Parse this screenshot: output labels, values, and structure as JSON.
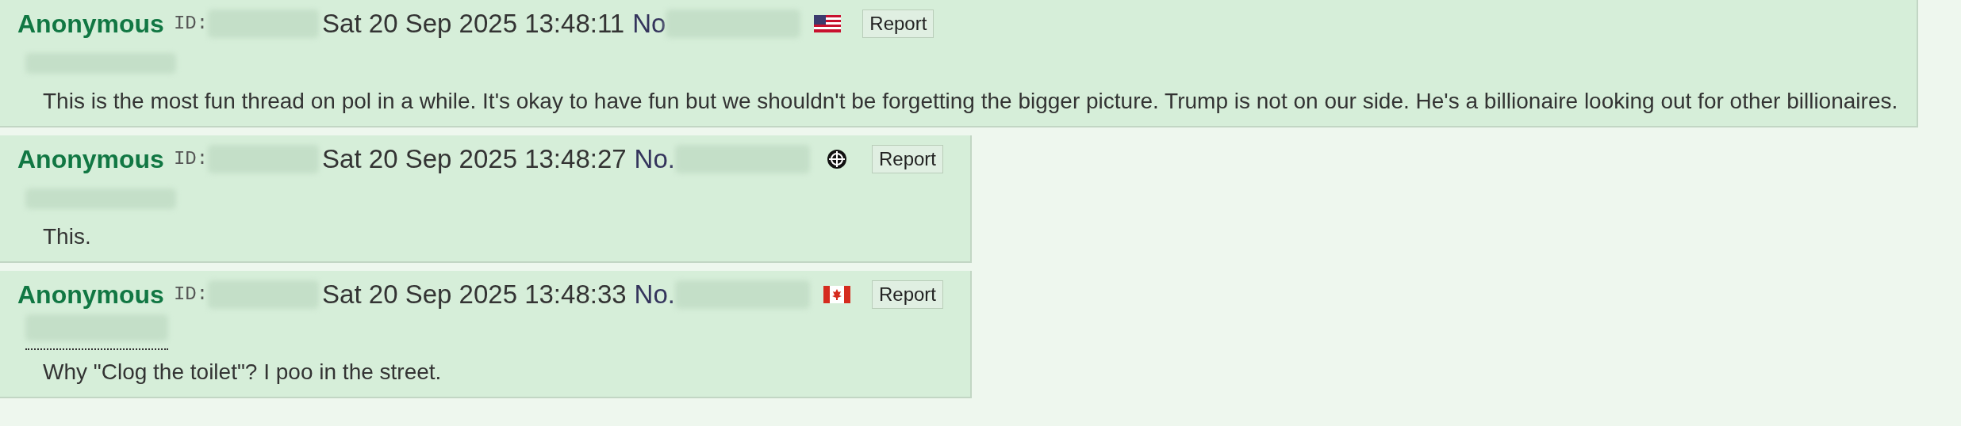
{
  "posts": [
    {
      "name": "Anonymous",
      "id_label": "ID:",
      "date": "Sat 20 Sep 2025 13:48:11",
      "number_label": "No",
      "badge": {
        "kind": "us_flag"
      },
      "report": "Report",
      "quote_underlined": false,
      "message": "This is the most fun thread on pol in a while. It's okay to have fun but we shouldn't be forgetting the bigger picture. Trump is not on our side. He's a billionaire looking out for other billionaires."
    },
    {
      "name": "Anonymous",
      "id_label": "ID:",
      "date": "Sat 20 Sep 2025 13:48:27",
      "number_label": "No.",
      "badge": {
        "kind": "crosshair"
      },
      "report": "Report",
      "quote_underlined": false,
      "message": "This."
    },
    {
      "name": "Anonymous",
      "id_label": "ID:",
      "date": "Sat 20 Sep 2025 13:48:33",
      "number_label": "No.",
      "badge": {
        "kind": "ca_flag"
      },
      "report": "Report",
      "quote_underlined": true,
      "message": "Why \"Clog the toilet\"? I poo in the street."
    }
  ]
}
